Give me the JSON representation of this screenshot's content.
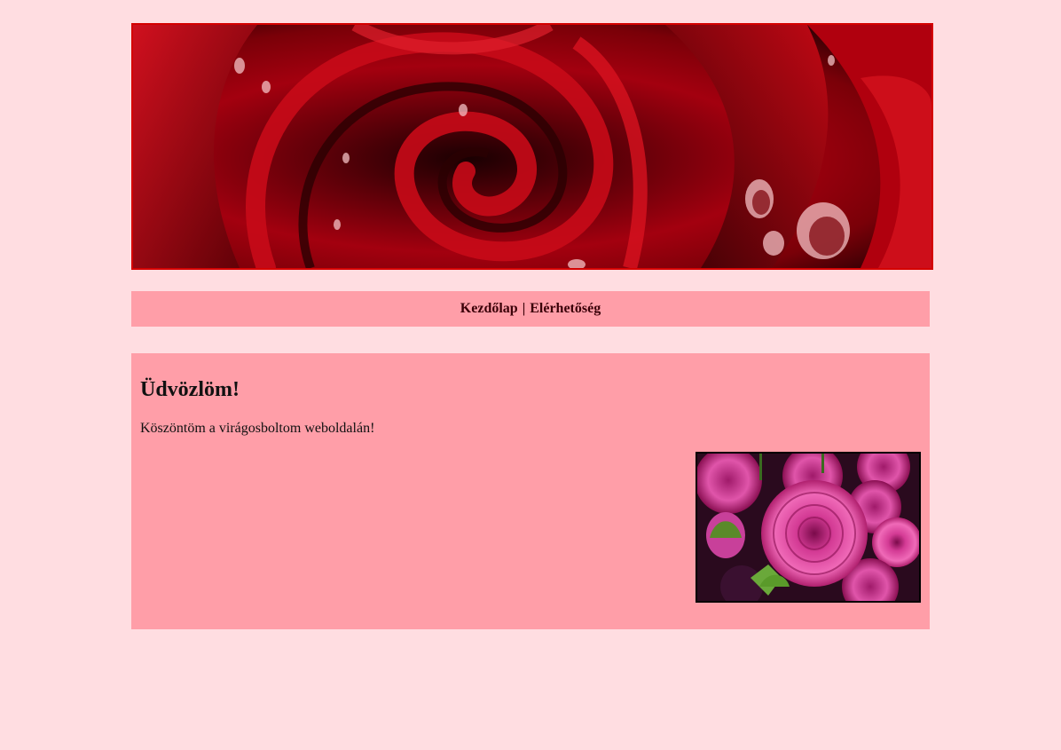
{
  "header": {
    "banner_image": "red-rose-banner-image"
  },
  "nav": {
    "items": [
      {
        "label": "Kezdőlap"
      },
      {
        "label": "Elérhetőség"
      }
    ],
    "separator": "|"
  },
  "main": {
    "title": "Üdvözlöm!",
    "intro": "Köszöntöm a virágosboltom weboldalán!",
    "image": "pink-dahlia-flowers-image"
  },
  "colors": {
    "page_background": "#ffdde1",
    "panel_background": "#ff9ea8",
    "banner_border": "#d40000",
    "image_border": "#000000"
  }
}
